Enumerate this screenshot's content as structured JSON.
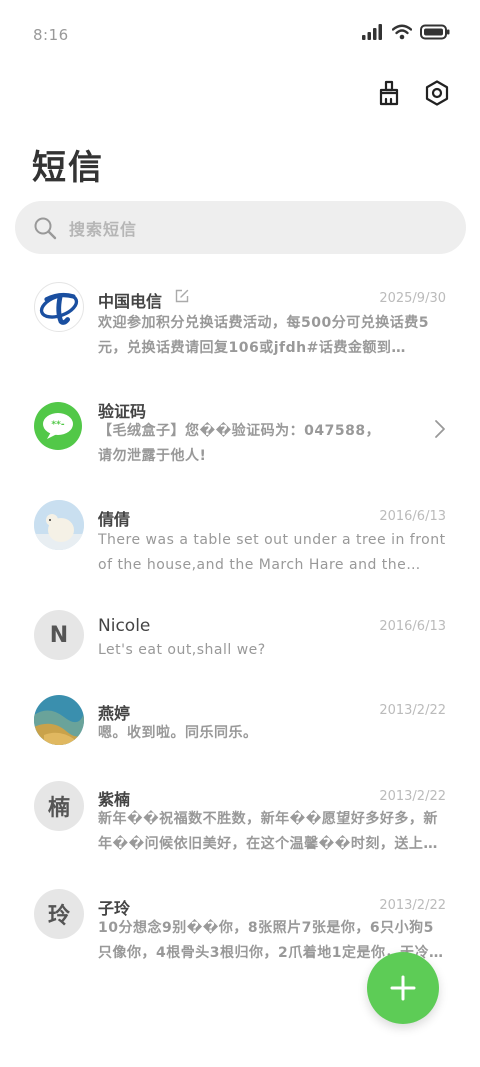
{
  "status_bar": {
    "time": "8:16"
  },
  "header": {
    "title": "短信"
  },
  "search": {
    "placeholder": "搜索短信"
  },
  "messages": [
    {
      "sender": "中国电信",
      "date": "2025/9/30",
      "preview": "欢迎参加积分兑换话费活动，每500分可兑换话费5元，兑换话费请回复106或jfdh#话费金额到10001…"
    },
    {
      "sender": "验证码",
      "date": "",
      "preview": "【毛绒盒子】您��验证码为：047588，请勿泄露于他人!"
    },
    {
      "sender": "倩倩",
      "date": "2016/6/13",
      "preview": "There was a table set out under a tree in front of the house,and the March Hare and the Hatt…"
    },
    {
      "sender": "Nicole",
      "date": "2016/6/13",
      "preview": "Let's eat out,shall we?",
      "avatar_letter": "N"
    },
    {
      "sender": "燕婷",
      "date": "2013/2/22",
      "preview": "嗯。收到啦。同乐同乐。"
    },
    {
      "sender": "紫楠",
      "date": "2013/2/22",
      "preview": "新年��祝福数不胜数，新年��愿望好多好多，新年��问候依旧美好，在这个温馨��时刻，送上我最…",
      "avatar_letter": "楠"
    },
    {
      "sender": "子玲",
      "date": "2013/2/22",
      "preview": "10分想念9别��你，8张照片7张是你，6只小狗5只像你，4根骨头3根归你，2爪着地1定是你，天冷了…",
      "avatar_letter": "玲"
    }
  ],
  "colors": {
    "accent_green": "#5dcc56",
    "telecom_blue": "#1a4fa0"
  }
}
